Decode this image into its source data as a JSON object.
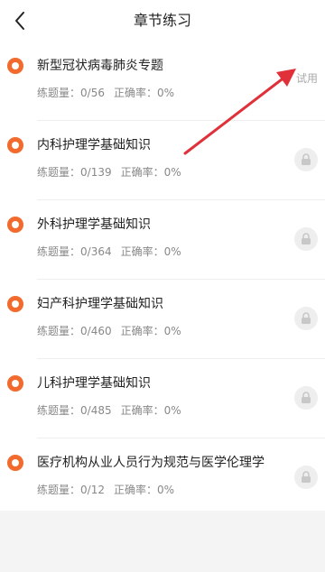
{
  "header": {
    "title": "章节练习"
  },
  "labels": {
    "count_prefix": "练题量：",
    "accuracy_prefix": "正确率："
  },
  "trial_label": "试用",
  "chapters": [
    {
      "name": "新型冠状病毒肺炎专题",
      "count": "0/56",
      "accuracy": "0%",
      "locked": false
    },
    {
      "name": "内科护理学基础知识",
      "count": "0/139",
      "accuracy": "0%",
      "locked": true
    },
    {
      "name": "外科护理学基础知识",
      "count": "0/364",
      "accuracy": "0%",
      "locked": true
    },
    {
      "name": "妇产科护理学基础知识",
      "count": "0/460",
      "accuracy": "0%",
      "locked": true
    },
    {
      "name": "儿科护理学基础知识",
      "count": "0/485",
      "accuracy": "0%",
      "locked": true
    },
    {
      "name": "医疗机构从业人员行为规范与医学伦理学",
      "count": "0/12",
      "accuracy": "0%",
      "locked": true
    }
  ],
  "colors": {
    "accent": "#f26a2e",
    "arrow": "#e0303a",
    "lock_bg": "#eeeeee"
  }
}
